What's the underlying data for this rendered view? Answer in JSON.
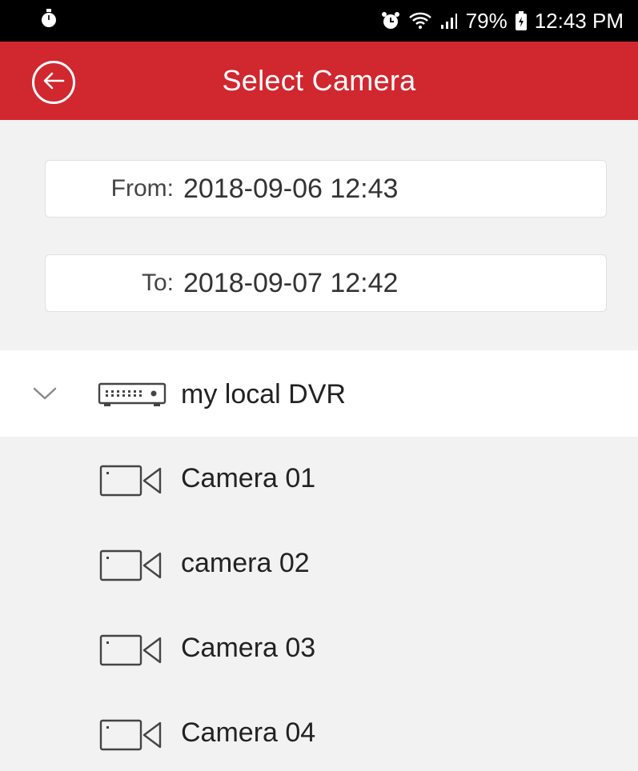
{
  "status_bar": {
    "battery": "79%",
    "time": "12:43 PM",
    "icons": [
      "stopwatch-icon",
      "alarm-icon",
      "wifi-icon",
      "signal-icon",
      "battery-icon"
    ]
  },
  "app_bar": {
    "title": "Select Camera",
    "back_icon": "back-arrow-icon",
    "color": "#d1272f"
  },
  "filters": {
    "from": {
      "label": "From:",
      "value": "2018-09-06  12:43"
    },
    "to": {
      "label": "To:",
      "value": "2018-09-07  12:42"
    }
  },
  "tree": {
    "group": {
      "label": "my local DVR",
      "expanded": true,
      "icon": "dvr-icon"
    },
    "cameras": [
      {
        "label": "Camera 01",
        "icon": "camera-icon"
      },
      {
        "label": "camera 02",
        "icon": "camera-icon"
      },
      {
        "label": "Camera 03",
        "icon": "camera-icon"
      },
      {
        "label": "Camera 04",
        "icon": "camera-icon"
      }
    ]
  }
}
